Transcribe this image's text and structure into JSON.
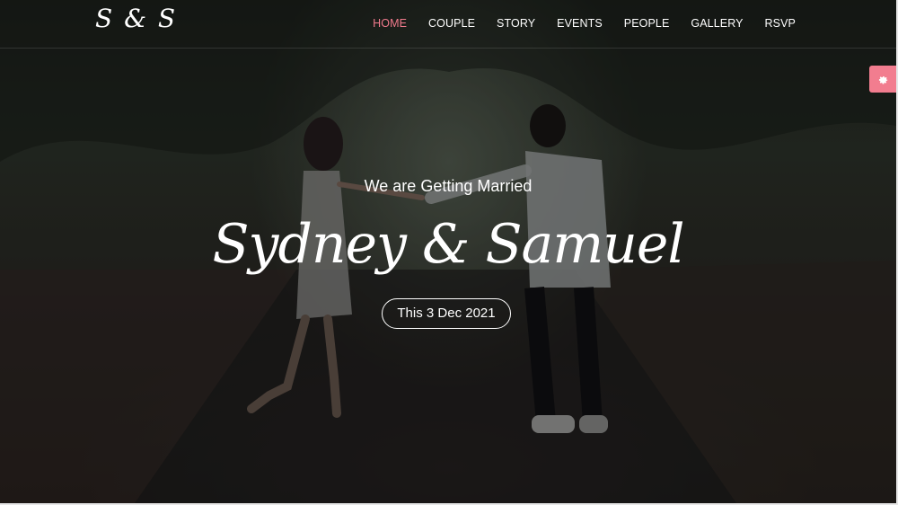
{
  "site": {
    "logo": "S & S"
  },
  "nav": {
    "items": [
      {
        "label": "HOME",
        "active": true
      },
      {
        "label": "COUPLE",
        "active": false
      },
      {
        "label": "STORY",
        "active": false
      },
      {
        "label": "EVENTS",
        "active": false
      },
      {
        "label": "PEOPLE",
        "active": false
      },
      {
        "label": "GALLERY",
        "active": false
      },
      {
        "label": "RSVP",
        "active": false
      }
    ]
  },
  "hero": {
    "tagline": "We are Getting Married",
    "names": "Sydney & Samuel",
    "date_label": "This 3 Dec 2021"
  },
  "settings_button": {
    "icon": "gear-icon"
  },
  "colors": {
    "accent": "#f07a8c",
    "settings_bg": "#f27d8f",
    "text": "#ffffff"
  }
}
